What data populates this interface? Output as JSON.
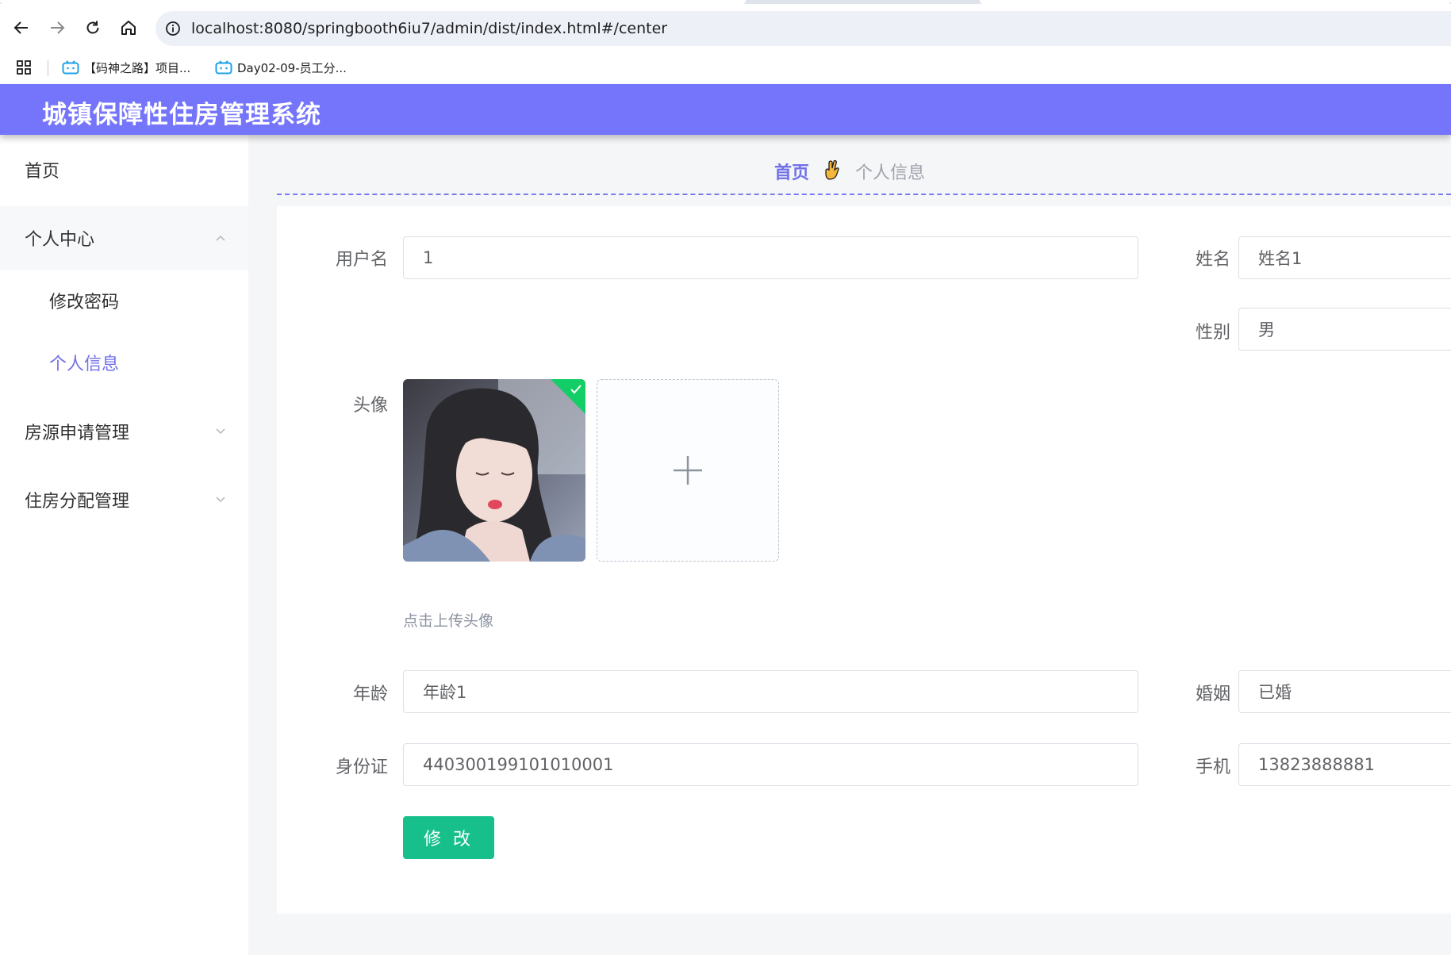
{
  "browser": {
    "url": "localhost:8080/springbooth6iu7/admin/dist/index.html#/center",
    "bookmarks": [
      {
        "label": "【码神之路】项目..."
      },
      {
        "label": "Day02-09-员工分..."
      }
    ]
  },
  "app": {
    "title": "城镇保障性住房管理系统"
  },
  "sidebar": {
    "items": [
      {
        "label": "首页"
      },
      {
        "label": "个人中心"
      },
      {
        "label": "修改密码"
      },
      {
        "label": "个人信息"
      },
      {
        "label": "房源申请管理"
      },
      {
        "label": "住房分配管理"
      }
    ],
    "active_item": "个人信息"
  },
  "breadcrumb": {
    "home": "首页",
    "current": "个人信息"
  },
  "form": {
    "username_label": "用户名",
    "username_value": "1",
    "name_label": "姓名",
    "name_value": "姓名1",
    "gender_label": "性别",
    "gender_value": "男",
    "avatar_label": "头像",
    "upload_hint": "点击上传头像",
    "age_label": "年龄",
    "age_value": "年龄1",
    "marriage_label": "婚姻",
    "marriage_value": "已婚",
    "idcard_label": "身份证",
    "idcard_value": "440300199101010001",
    "phone_label": "手机",
    "phone_value": "13823888881",
    "submit_label": "修 改"
  },
  "colors": {
    "header": "#7575fb",
    "accent": "#7171e8",
    "submit": "#17c08a"
  }
}
